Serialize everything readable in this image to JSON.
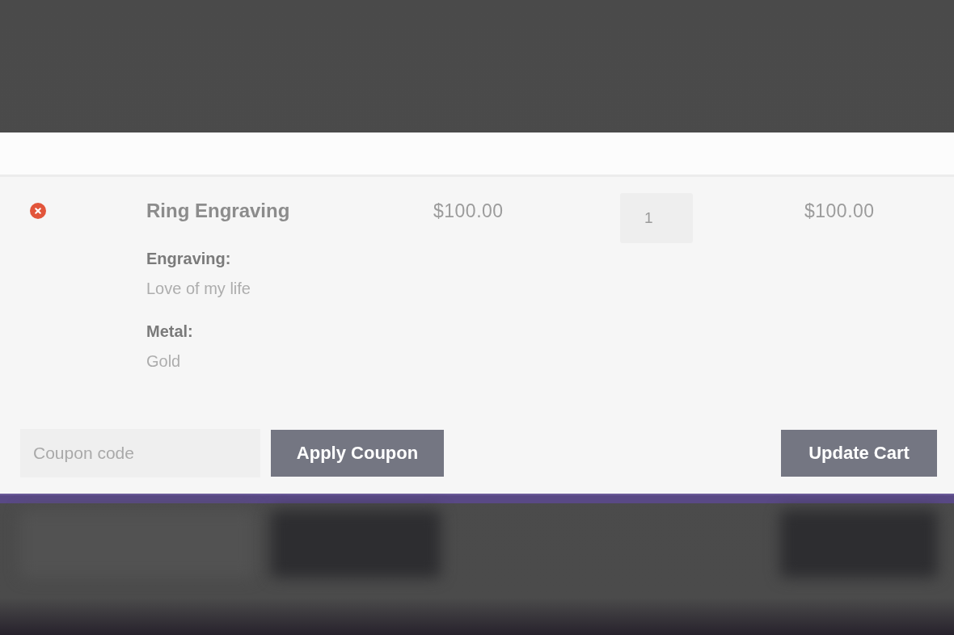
{
  "cart": {
    "items": [
      {
        "name": "Ring Engraving",
        "options": [
          {
            "label": "Engraving:",
            "value": "Love of my life"
          },
          {
            "label": "Metal:",
            "value": "Gold"
          }
        ],
        "price": "$100.00",
        "quantity": "1",
        "subtotal": "$100.00"
      }
    ],
    "coupon": {
      "placeholder": "Coupon code"
    },
    "apply_button": "Apply Coupon",
    "update_button": "Update Cart"
  }
}
